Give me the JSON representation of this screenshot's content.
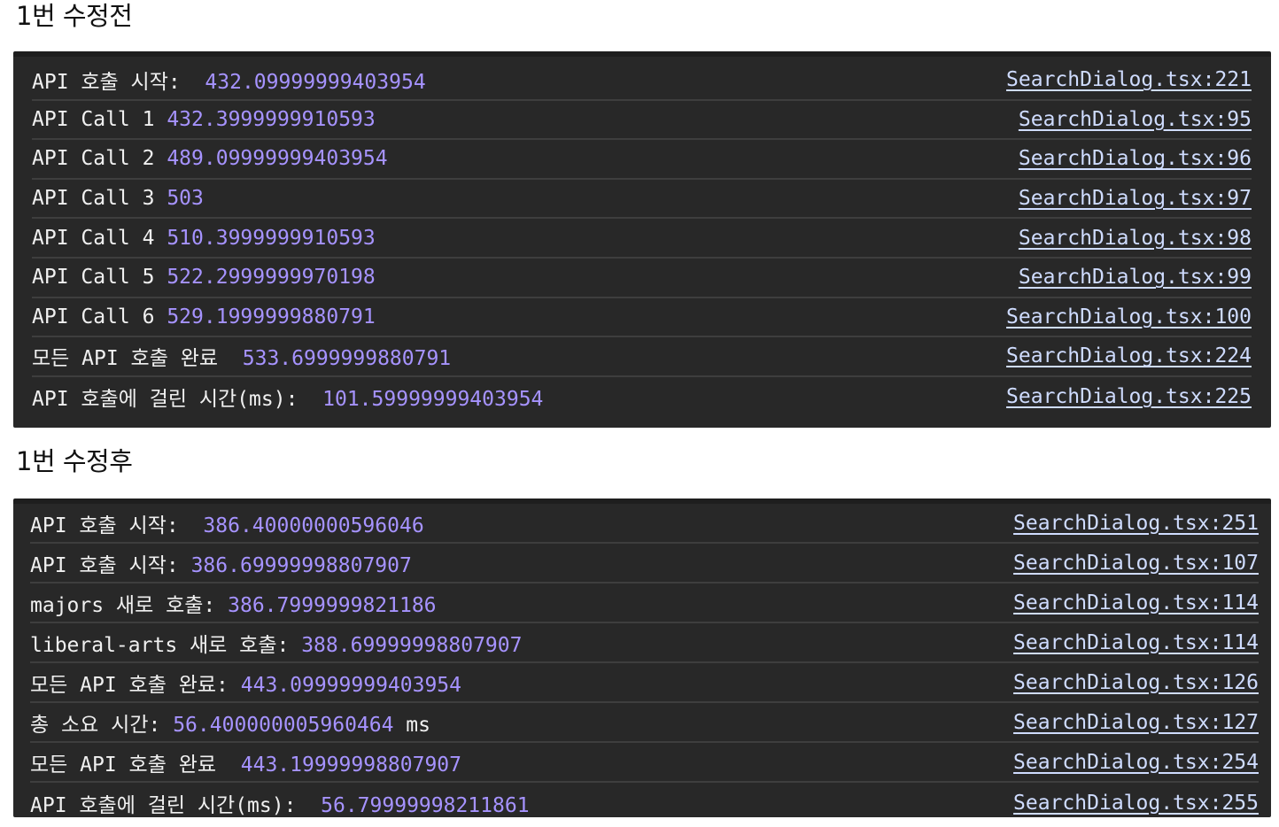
{
  "section1": {
    "title": "1번 수정전",
    "rows": [
      {
        "label": "API 호출 시작:  ",
        "value": "432.09999999403954",
        "suffix": "",
        "source": "SearchDialog.tsx:221"
      },
      {
        "label": "API Call 1 ",
        "value": "432.3999999910593",
        "suffix": "",
        "source": "SearchDialog.tsx:95"
      },
      {
        "label": "API Call 2 ",
        "value": "489.09999999403954",
        "suffix": "",
        "source": "SearchDialog.tsx:96"
      },
      {
        "label": "API Call 3 ",
        "value": "503",
        "suffix": "",
        "source": "SearchDialog.tsx:97"
      },
      {
        "label": "API Call 4 ",
        "value": "510.3999999910593",
        "suffix": "",
        "source": "SearchDialog.tsx:98"
      },
      {
        "label": "API Call 5 ",
        "value": "522.2999999970198",
        "suffix": "",
        "source": "SearchDialog.tsx:99"
      },
      {
        "label": "API Call 6 ",
        "value": "529.1999999880791",
        "suffix": "",
        "source": "SearchDialog.tsx:100"
      },
      {
        "label": "모든 API 호출 완료  ",
        "value": "533.6999999880791",
        "suffix": "",
        "source": "SearchDialog.tsx:224"
      },
      {
        "label": "API 호출에 걸린 시간(ms):  ",
        "value": "101.59999999403954",
        "suffix": "",
        "source": "SearchDialog.tsx:225"
      }
    ]
  },
  "section2": {
    "title": "1번 수정후",
    "rows": [
      {
        "label": "API 호출 시작:  ",
        "value": "386.40000000596046",
        "suffix": "",
        "source": "SearchDialog.tsx:251"
      },
      {
        "label": "API 호출 시작: ",
        "value": "386.69999998807907",
        "suffix": "",
        "source": "SearchDialog.tsx:107"
      },
      {
        "label": "majors 새로 호출: ",
        "value": "386.7999999821186",
        "suffix": "",
        "source": "SearchDialog.tsx:114"
      },
      {
        "label": "liberal-arts 새로 호출: ",
        "value": "388.69999998807907",
        "suffix": "",
        "source": "SearchDialog.tsx:114"
      },
      {
        "label": "모든 API 호출 완료: ",
        "value": "443.09999999403954",
        "suffix": "",
        "source": "SearchDialog.tsx:126"
      },
      {
        "label": "총 소요 시간: ",
        "value": "56.400000005960464",
        "suffix": " ms",
        "source": "SearchDialog.tsx:127"
      },
      {
        "label": "모든 API 호출 완료  ",
        "value": "443.19999998807907",
        "suffix": "",
        "source": "SearchDialog.tsx:254"
      },
      {
        "label": "API 호출에 걸린 시간(ms):  ",
        "value": "56.79999998211861",
        "suffix": "",
        "source": "SearchDialog.tsx:255"
      }
    ]
  },
  "colors": {
    "console_bg": "#282828",
    "message_text": "#f0f0f0",
    "number_text": "#a693ff",
    "source_link": "#cfdcff"
  }
}
